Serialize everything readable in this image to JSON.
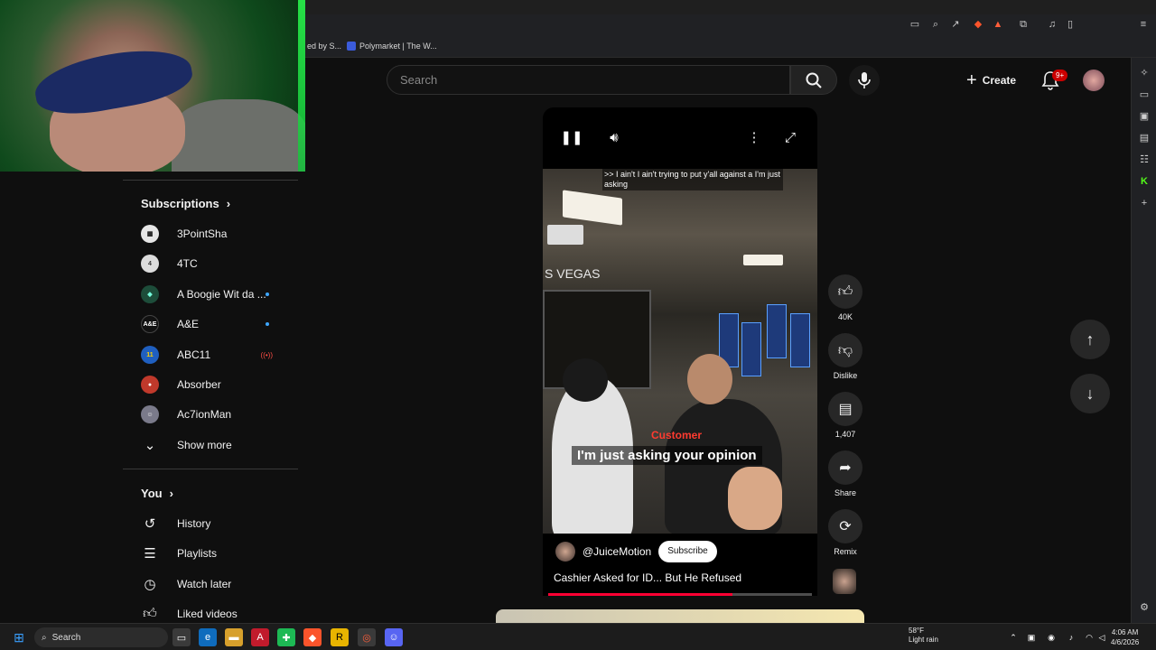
{
  "browser": {
    "bookmarks": [
      {
        "label": "ed by S..."
      },
      {
        "label": "Polymarket | The W..."
      }
    ]
  },
  "header": {
    "search_placeholder": "Search",
    "create_label": "Create",
    "notification_count": "9+"
  },
  "sidebar": {
    "subscriptions_title": "Subscriptions",
    "subscriptions": [
      {
        "label": "3PointSha",
        "badge": "",
        "avatar_color": "#e6e6e6"
      },
      {
        "label": "4TC",
        "badge": "",
        "avatar_color": "#dcdcdc"
      },
      {
        "label": "A Boogie Wit da ...",
        "badge": "dot",
        "avatar_color": "#1d4d3a"
      },
      {
        "label": "A&E",
        "badge": "dot",
        "avatar_color": "#111111"
      },
      {
        "label": "ABC11",
        "badge": "live",
        "avatar_color": "#1f5fbf"
      },
      {
        "label": "Absorber",
        "badge": "",
        "avatar_color": "#c0392b"
      },
      {
        "label": "Ac7ionMan",
        "badge": "",
        "avatar_color": "#7a7a8a"
      }
    ],
    "show_more": "Show more",
    "you_title": "You",
    "you_items": [
      {
        "label": "History",
        "icon": "history-icon"
      },
      {
        "label": "Playlists",
        "icon": "playlists-icon"
      },
      {
        "label": "Watch later",
        "icon": "clock-icon"
      },
      {
        "label": "Liked videos",
        "icon": "thumbs-up-icon"
      }
    ]
  },
  "video": {
    "top_caption": ">> I ain't I ain't trying to put y'all against a I'm just asking",
    "speaker_label": "Customer",
    "subtitle": "I'm just asking your opinion",
    "channel": "@JuiceMotion",
    "subscribe_label": "Subscribe",
    "title": "Cashier Asked for ID... But He Refused",
    "sign_text": "S VEGAS",
    "progress": 0.7
  },
  "actions": {
    "like_count": "40K",
    "dislike_label": "Dislike",
    "comment_count": "1,407",
    "share_label": "Share",
    "remix_label": "Remix"
  },
  "taskbar": {
    "search_label": "Search",
    "weather_temp": "58°F",
    "weather_desc": "Light rain",
    "time": "4:06 AM",
    "date": "4/6/2026"
  },
  "colors": {
    "accent_red": "#ff0033",
    "badge_red": "#cc0000",
    "live_red": "#ff4e45",
    "dot_blue": "#3ea6ff",
    "webcam_green": "#2bff4f"
  }
}
